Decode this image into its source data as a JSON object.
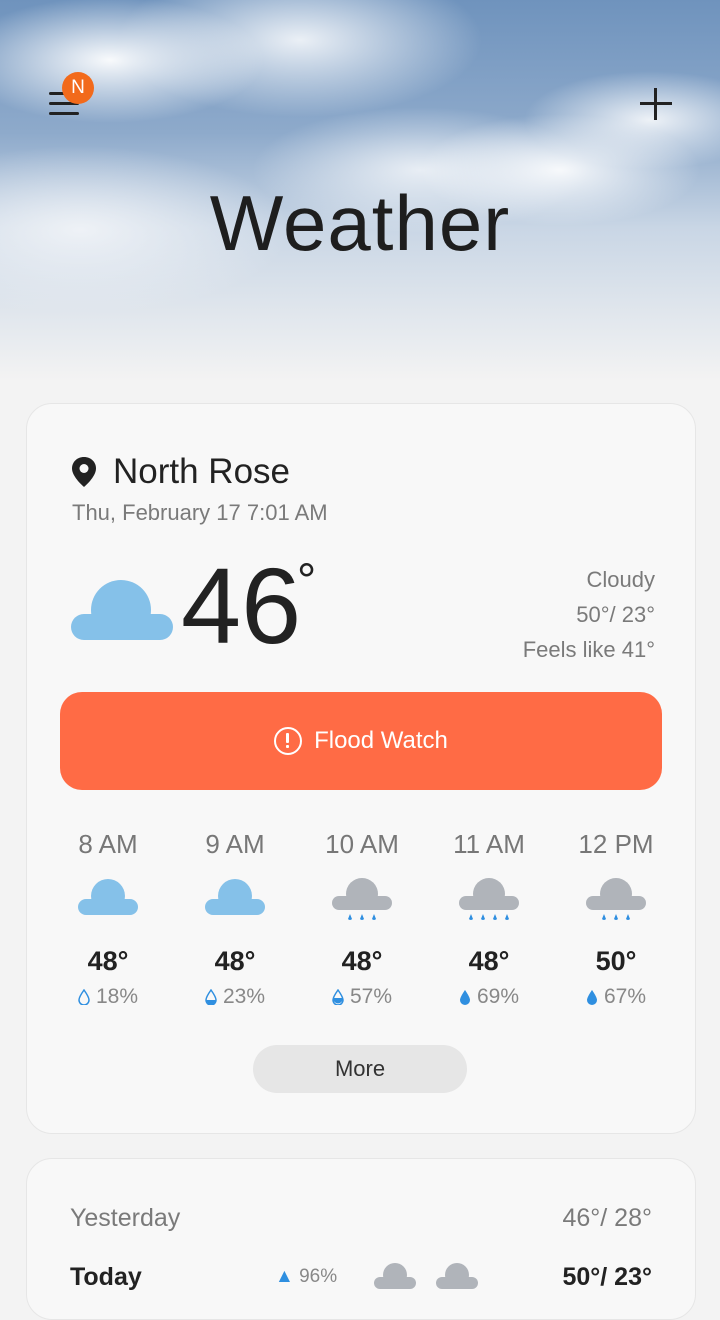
{
  "header": {
    "title": "Weather",
    "notification_badge": "N",
    "menu_icon": "hamburger-menu-icon",
    "add_icon": "plus-icon"
  },
  "current": {
    "location": "North Rose",
    "datetime": "Thu, February 17 7:01 AM",
    "temperature": "46",
    "degree_symbol": "°",
    "condition": "Cloudy",
    "high_low": "50°/ 23°",
    "feels_like": "Feels like 41°",
    "condition_icon": "cloud-icon"
  },
  "alert": {
    "label": "Flood Watch",
    "color": "#ff6b45",
    "icon": "alert-circle-icon"
  },
  "hourly": [
    {
      "time": "8 AM",
      "temp": "48°",
      "precip": "18%",
      "icon": "cloud-icon"
    },
    {
      "time": "9 AM",
      "temp": "48°",
      "precip": "23%",
      "icon": "cloud-icon"
    },
    {
      "time": "10 AM",
      "temp": "48°",
      "precip": "57%",
      "icon": "rain-cloud-icon"
    },
    {
      "time": "11 AM",
      "temp": "48°",
      "precip": "69%",
      "icon": "rain-cloud-icon"
    },
    {
      "time": "12 PM",
      "temp": "50°",
      "precip": "67%",
      "icon": "rain-cloud-icon"
    }
  ],
  "more_label": "More",
  "daily": {
    "yesterday_label": "Yesterday",
    "yesterday_temp": "46°/ 28°",
    "today_label": "Today",
    "today_precip": "96%",
    "today_temp": "50°/ 23°"
  },
  "colors": {
    "accent_orange": "#ff6b45",
    "badge_orange": "#f26a1b",
    "cloud_blue": "#85c1e9",
    "rain_cloud_gray": "#b0b4ba",
    "rain_drop_blue": "#2f8fe0"
  }
}
